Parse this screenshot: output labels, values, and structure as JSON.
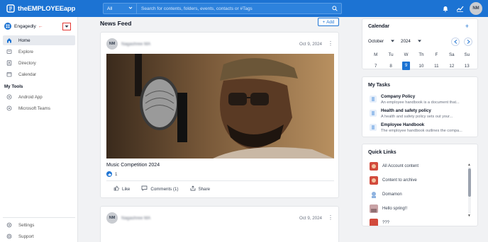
{
  "app": {
    "logo_text": "theEMPLOYEEapp"
  },
  "search": {
    "scope": "All",
    "placeholder": "Search for contents, folders, events, contacts or #Tags"
  },
  "topbar": {
    "user_initials": "NM"
  },
  "sidebar": {
    "workspace": "Engagedly",
    "items": [
      {
        "label": "Home",
        "icon": "home-icon",
        "active": true
      },
      {
        "label": "Explore",
        "icon": "explore-icon"
      },
      {
        "label": "Directory",
        "icon": "directory-icon"
      },
      {
        "label": "Calendar",
        "icon": "calendar-icon"
      }
    ],
    "tools_title": "My Tools",
    "tools": [
      {
        "label": "Android App",
        "icon": "app-icon"
      },
      {
        "label": "Microsoft Teams",
        "icon": "app-icon"
      }
    ],
    "bottom": [
      {
        "label": "Settings",
        "icon": "settings-icon"
      },
      {
        "label": "Support",
        "icon": "support-icon"
      }
    ]
  },
  "feed": {
    "title": "News Feed",
    "add_label": "Add",
    "posts": [
      {
        "initials": "NM",
        "author": "Nagashree MA",
        "date": "Oct 9, 2024",
        "title": "Music Competition 2024",
        "likes": "1",
        "actions": {
          "like": "Like",
          "comments": "Comments (1)",
          "share": "Share"
        }
      },
      {
        "initials": "NM",
        "author": "Nagashree MA",
        "date": "Oct 9, 2024"
      }
    ]
  },
  "calendar": {
    "title": "Calendar",
    "month": "October",
    "year": "2024",
    "weekdays": [
      "M",
      "Tu",
      "W",
      "Th",
      "F",
      "Sa",
      "Su"
    ],
    "days": [
      "7",
      "8",
      "9",
      "10",
      "11",
      "12",
      "13"
    ],
    "today": "9"
  },
  "tasks": {
    "title": "My Tasks",
    "items": [
      {
        "title": "Company Policy",
        "desc": "An employee handbook is a document that..."
      },
      {
        "title": "Health and safety policy",
        "desc": "A health and safety policy sets out your..."
      },
      {
        "title": "Employee Handbook",
        "desc": "The employee handbook outlines the compa..."
      }
    ]
  },
  "quick_links": {
    "title": "Quick Links",
    "items": [
      {
        "label": "All Account content",
        "color": "#d24a3c"
      },
      {
        "label": "Content to archive",
        "color": "#d24a3c"
      },
      {
        "label": "Domamon",
        "color": "#8fb3e0"
      },
      {
        "label": "Hello spring!!",
        "color": "#c9a3a6"
      },
      {
        "label": "???",
        "color": "#d24a3c"
      }
    ]
  },
  "colors": {
    "brand": "#1c73d3",
    "highlight": "#e53935"
  }
}
